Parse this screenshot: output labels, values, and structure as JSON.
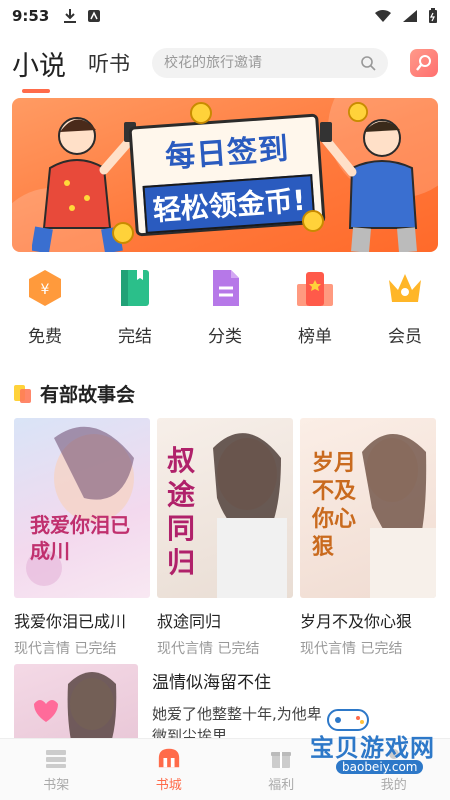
{
  "status_bar": {
    "time": "9:53"
  },
  "header": {
    "tab_active": "小说",
    "tab_other": "听书",
    "search_placeholder": "校花的旅行邀请"
  },
  "banner": {
    "line1": "每日签到",
    "line2": "轻松领金币!"
  },
  "categories": [
    {
      "label": "免费",
      "icon": "coin-hexagon-icon"
    },
    {
      "label": "完结",
      "icon": "book-icon"
    },
    {
      "label": "分类",
      "icon": "document-icon"
    },
    {
      "label": "榜单",
      "icon": "ranking-icon"
    },
    {
      "label": "会员",
      "icon": "crown-icon"
    }
  ],
  "section": {
    "title": "有部故事会"
  },
  "books": [
    {
      "name": "我爱你泪已成川",
      "tags": "现代言情 已完结",
      "cover_title": "我爱你泪已成川"
    },
    {
      "name": "叔途同归",
      "tags": "现代言情 已完结",
      "cover_title": "叔途同归"
    },
    {
      "name": "岁月不及你心狠",
      "tags": "现代言情 已完结",
      "cover_title": "岁月不及你心狠"
    }
  ],
  "featured_book": {
    "name": "温情似海留不住",
    "desc": "她爱了他整整十年,为他卑微到尘埃里"
  },
  "bottom_nav": [
    {
      "label": "书架",
      "icon": "bookshelf-icon",
      "active": false
    },
    {
      "label": "书城",
      "icon": "store-icon",
      "active": true
    },
    {
      "label": "福利",
      "icon": "gift-icon",
      "active": false
    },
    {
      "label": "我的",
      "icon": "profile-icon",
      "active": false
    }
  ],
  "watermark": {
    "text": "宝贝游戏网",
    "url": "baobeiy.com"
  },
  "colors": {
    "accent": "#ff6b4a",
    "banner": "#ff7a3d"
  }
}
